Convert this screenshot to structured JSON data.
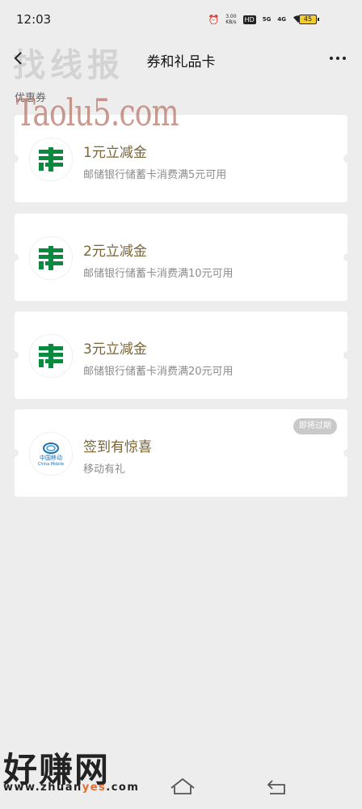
{
  "status_bar": {
    "time": "12:03",
    "speed": "3.00",
    "speed_unit": "KB/s",
    "hd": "HD",
    "net_5g": "5G",
    "net_4g": "4G",
    "battery": "45"
  },
  "header": {
    "title": "券和礼品卡",
    "back_icon": "chevron-left-icon",
    "more_icon": "ellipsis-icon"
  },
  "section_label": "优惠券",
  "coupons": [
    {
      "title": "1元立减金",
      "desc": "邮储银行储蓄卡消费满5元可用",
      "logo": "china-post-logo"
    },
    {
      "title": "2元立减金",
      "desc": "邮储银行储蓄卡消费满10元可用",
      "logo": "china-post-logo"
    },
    {
      "title": "3元立减金",
      "desc": "邮储银行储蓄卡消费满20元可用",
      "logo": "china-post-logo"
    },
    {
      "title": "签到有惊喜",
      "desc": "移动有礼",
      "logo": "china-mobile-logo",
      "logo_text_cn": "中国移动",
      "logo_text_en": "China Mobile",
      "badge": "即将过期"
    }
  ],
  "watermarks": {
    "top_cn": "找线报",
    "top_en": "Taolu5.com",
    "bottom_cn": "好赚网",
    "bottom_url_a": "www.zhuan",
    "bottom_url_b": "yes",
    "bottom_url_c": ".com"
  },
  "colors": {
    "background": "#ededed",
    "coupon_title": "#7a6433",
    "post_green": "#0a8a3e",
    "mobile_blue": "#1e6fb6"
  }
}
